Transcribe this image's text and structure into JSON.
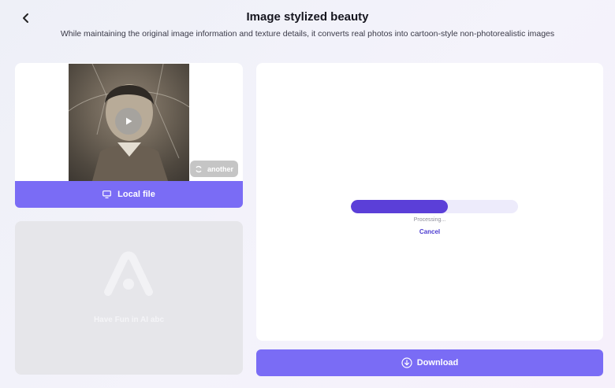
{
  "header": {
    "title": "Image stylized beauty",
    "subtitle": "While maintaining the original image information and texture details, it converts real photos into cartoon-style non-photorealistic images",
    "back_icon": "chevron-left-icon"
  },
  "upload": {
    "another_label": "another",
    "another_icon": "refresh-icon",
    "play_icon": "play-icon",
    "local_file_label": "Local file",
    "local_file_icon": "monitor-icon"
  },
  "placeholder": {
    "text": "Have Fun in AI abc",
    "logo_icon": "ai-logo-icon"
  },
  "result": {
    "progress": 0.58,
    "processing_text": "Processing...",
    "cancel_label": "Cancel"
  },
  "actions": {
    "download_label": "Download",
    "download_icon": "download-circle-icon"
  },
  "colors": {
    "accent": "#7a6cf5",
    "progress_fill": "#5b3fd8",
    "progress_track": "#edebfb"
  }
}
